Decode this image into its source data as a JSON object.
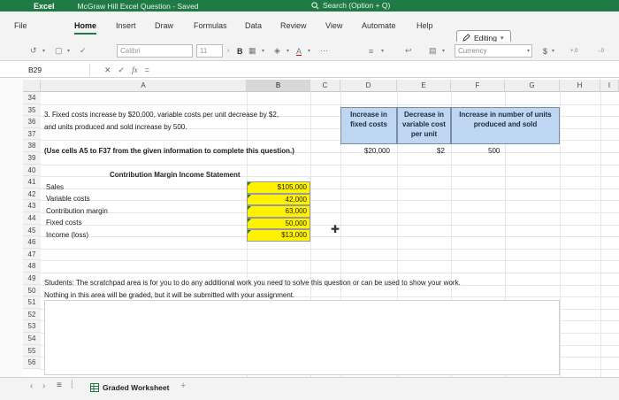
{
  "titlebar": {
    "app_name": "Excel",
    "doc_title": "McGraw Hill Excel Question  -  Saved",
    "search_text": "Search (Option + Q)"
  },
  "ribbon": {
    "tabs": [
      "File",
      "Home",
      "Insert",
      "Draw",
      "Formulas",
      "Data",
      "Review",
      "View",
      "Automate",
      "Help"
    ],
    "active_tab": "Home",
    "editing_label": "Editing"
  },
  "toolbar": {
    "font_name": "Calibri",
    "font_size": "11",
    "bold_label": "B",
    "number_format": "Currency",
    "currency_symbol": "$"
  },
  "formula_bar": {
    "name_box": "B29",
    "fx_label": "fx",
    "formula": "="
  },
  "columns": [
    "A",
    "B",
    "C",
    "D",
    "E",
    "F",
    "G",
    "H",
    "I"
  ],
  "selected_column": "B",
  "rows": [
    "34",
    "35",
    "36",
    "37",
    "38",
    "39",
    "40",
    "41",
    "42",
    "43",
    "44",
    "45",
    "46",
    "47",
    "48",
    "49",
    "50",
    "51",
    "52",
    "53",
    "54",
    "55",
    "56"
  ],
  "question": {
    "line1": "3. Fixed costs increase by $20,000, variable costs per unit decrease by $2,",
    "line2": "and units produced and sold increase by 500.",
    "instruction": "(Use cells A5 to F37 from the given information to complete this question.)"
  },
  "change_table": {
    "headers": [
      [
        "Increase in",
        "fixed costs"
      ],
      [
        "Decrease in",
        "variable cost",
        "per unit"
      ],
      [
        "Increase in number of units",
        "produced and sold"
      ]
    ],
    "values": [
      "$20,000",
      "$2",
      "500"
    ]
  },
  "statement": {
    "title": "Contribution Margin Income Statement",
    "labels": [
      "Sales",
      "Variable costs",
      "Contribution margin",
      "Fixed costs",
      "Income (loss)"
    ],
    "values": [
      "$105,000",
      "42,000",
      "63,000",
      "50,000",
      "$13,000"
    ]
  },
  "scratch_note": {
    "line1": "Students: The scratchpad area is for you to do any additional work you need to solve this question or can be used to show your work.",
    "line2": "Nothing in this area will be graded, but it will be submitted with your assignment."
  },
  "sheet_tabs": [
    "Graded Worksheet"
  ],
  "colors": {
    "brand": "#1f7a45",
    "header_fill": "#bfd6f2",
    "input_fill": "#fff200"
  }
}
